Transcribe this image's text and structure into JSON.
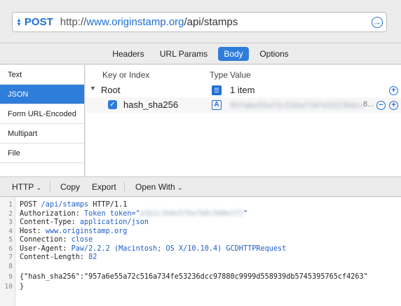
{
  "request": {
    "method": "POST",
    "url_scheme": "http://",
    "url_host": "www.originstamp.org",
    "url_path": "/api/stamps"
  },
  "tabs": [
    {
      "label": "Headers",
      "active": false
    },
    {
      "label": "URL Params",
      "active": false
    },
    {
      "label": "Body",
      "active": true
    },
    {
      "label": "Options",
      "active": false
    }
  ],
  "body_types": [
    {
      "label": "Text",
      "active": false
    },
    {
      "label": "JSON",
      "active": true
    },
    {
      "label": "Form URL-Encoded",
      "active": false
    },
    {
      "label": "Multipart",
      "active": false
    },
    {
      "label": "File",
      "active": false
    }
  ],
  "json_editor": {
    "col_key": "Key or Index",
    "col_type": "Type",
    "col_value": "Value",
    "root_key": "Root",
    "root_value": "1 item",
    "field_key": "hash_sha256",
    "field_value_redacted": "957a6e55a72c516a734fe53236dcc97880c99",
    "field_value_suffix": "8..."
  },
  "lower_toolbar": {
    "format": "HTTP",
    "copy": "Copy",
    "export": "Export",
    "open_with": "Open With"
  },
  "code": {
    "line1_a": "POST ",
    "line1_b": "/api/stamps",
    "line1_c": " HTTP/1.1",
    "line2_a": "Authorization: ",
    "line2_b": "Token token=\"",
    "line2_c": "a1b2c3d4e5f6a7b8c9d0e1f2",
    "line2_d": "\"",
    "line3_a": "Content-Type: ",
    "line3_b": "application/json",
    "line4_a": "Host: ",
    "line4_b": "www.originstamp.org",
    "line5_a": "Connection: ",
    "line5_b": "close",
    "line6_a": "User-Agent: ",
    "line6_b": "Paw/2.2.2 (Macintosh; OS X/10.10.4) GCDHTTPRequest",
    "line7_a": "Content-Length: ",
    "line7_b": "82",
    "line9": "{\"hash_sha256\":\"957a6e55a72c516a734fe53236dcc97880c9999d558939db5745395765cf4263\"",
    "line10": "}",
    "line_numbers": [
      "1",
      "2",
      "3",
      "4",
      "5",
      "6",
      "7",
      "8",
      "9",
      "10"
    ]
  }
}
